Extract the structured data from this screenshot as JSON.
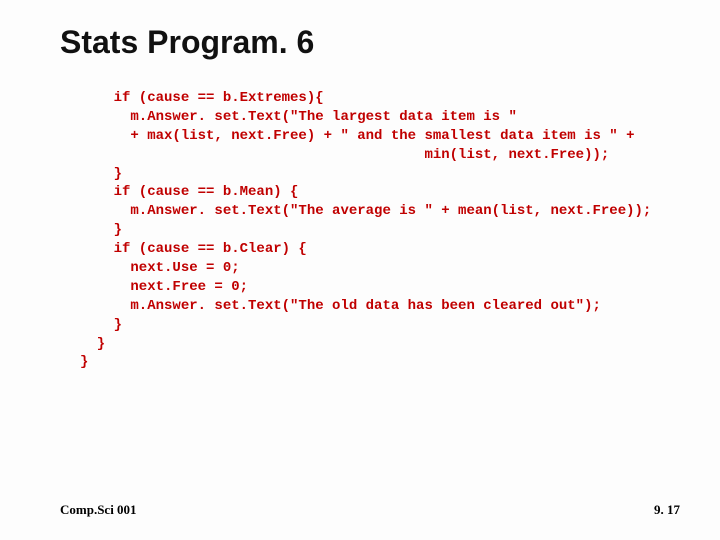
{
  "title": "Stats Program. 6",
  "code": "    if (cause == b.Extremes){\n      m.Answer. set.Text(\"The largest data item is \"\n      + max(list, next.Free) + \" and the smallest data item is \" +\n                                         min(list, next.Free));\n    }\n    if (cause == b.Mean) {\n      m.Answer. set.Text(\"The average is \" + mean(list, next.Free));\n    }\n    if (cause == b.Clear) {\n      next.Use = 0;\n      next.Free = 0;\n      m.Answer. set.Text(\"The old data has been cleared out\");\n    }\n  }\n}",
  "footer": {
    "left": "Comp.Sci 001",
    "right": "9. 17"
  }
}
